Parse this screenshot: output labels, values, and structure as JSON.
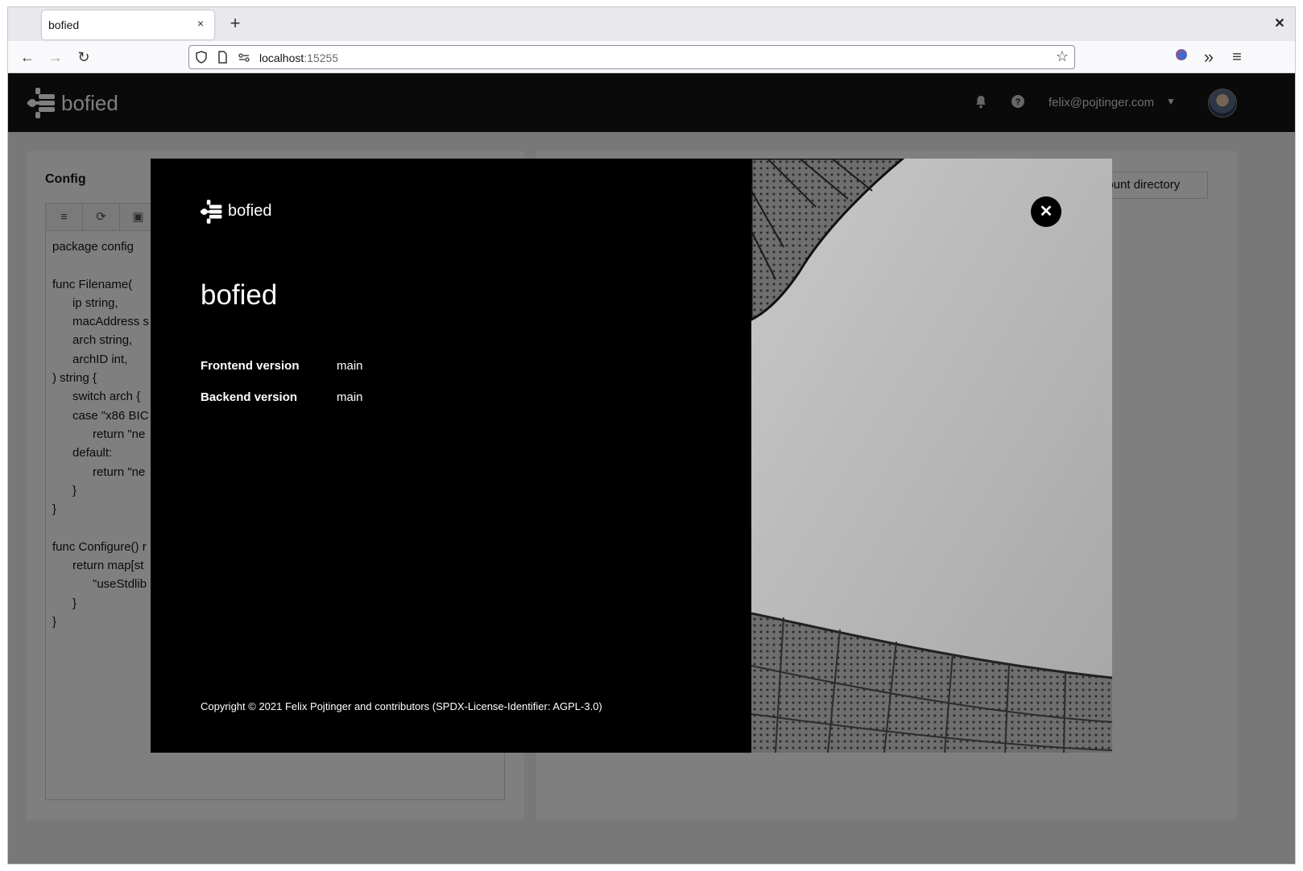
{
  "browser": {
    "tab_title": "bofied",
    "tab_close": "×",
    "new_tab": "+",
    "window_close": "✕",
    "url_host": "localhost",
    "url_port": ":15255",
    "back_icon": "←",
    "forward_icon": "→",
    "reload_icon": "↻",
    "bookmark_icon": "☆",
    "extensions_icon": "»",
    "menu_icon": "≡"
  },
  "header": {
    "brand": "bofied",
    "user_email": "felix@pojtinger.com",
    "bell_icon": "bell-icon",
    "help_icon": "help-icon"
  },
  "config": {
    "title": "Config",
    "code_lines": [
      "package config",
      "",
      "func Filename(",
      "      ip string,",
      "      macAddress s",
      "      arch string,",
      "      archID int,",
      ") string {",
      "      switch arch {",
      "      case \"x86 BIC",
      "            return \"ne",
      "      default:",
      "            return \"ne",
      "      }",
      "}",
      "",
      "func Configure() r",
      "      return map[st",
      "            \"useStdlib",
      "      }",
      "}"
    ]
  },
  "files": {
    "mount_button": "lount directory"
  },
  "about_modal": {
    "brand": "bofied",
    "title": "bofied",
    "frontend_label": "Frontend version",
    "frontend_value": "main",
    "backend_label": "Backend version",
    "backend_value": "main",
    "copyright": "Copyright © 2021 Felix Pojtinger and contributors (SPDX-License-Identifier: AGPL-3.0)",
    "close_icon": "✕"
  }
}
